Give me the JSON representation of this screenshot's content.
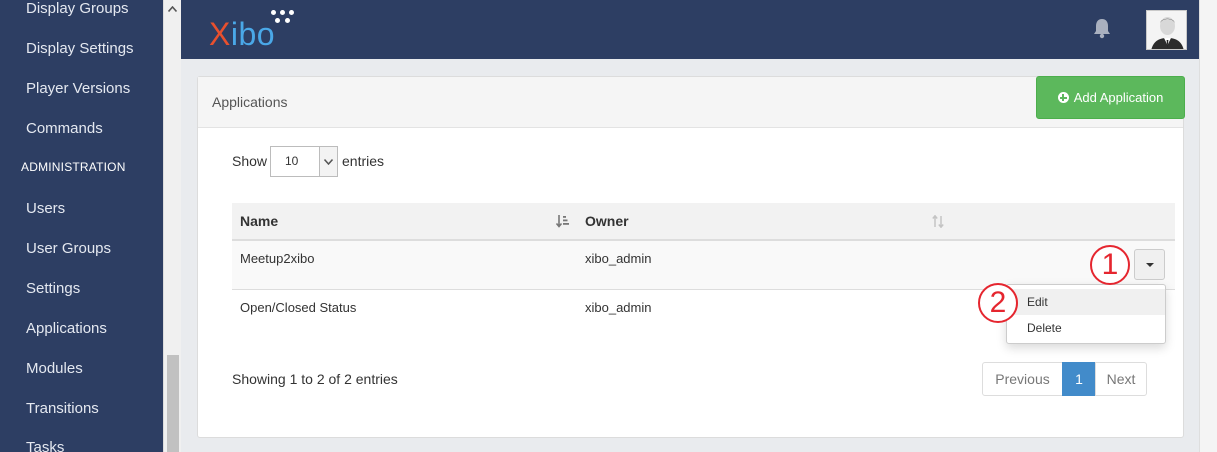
{
  "sidebar": {
    "items": [
      {
        "label": "Display Groups"
      },
      {
        "label": "Display Settings"
      },
      {
        "label": "Player Versions"
      },
      {
        "label": "Commands"
      },
      {
        "label": "Users"
      },
      {
        "label": "User Groups"
      },
      {
        "label": "Settings"
      },
      {
        "label": "Applications"
      },
      {
        "label": "Modules"
      },
      {
        "label": "Transitions"
      },
      {
        "label": "Tasks"
      }
    ],
    "section_admin": "ADMINISTRATION"
  },
  "navbar": {
    "logo_x": "X",
    "logo_rest": "ibo",
    "icons": {
      "notifications": "bell-icon",
      "user": "avatar"
    }
  },
  "panel": {
    "title": "Applications",
    "add_button": "Add Application",
    "add_button_icon": "plus-circle-icon"
  },
  "length": {
    "show_label": "Show",
    "value": "10",
    "entries_label": "entries"
  },
  "table": {
    "columns": [
      "Name",
      "Owner"
    ],
    "rows": [
      {
        "name": "Meetup2xibo",
        "owner": "xibo_admin"
      },
      {
        "name": "Open/Closed Status",
        "owner": "xibo_admin"
      }
    ]
  },
  "row_menu": {
    "items": [
      "Edit",
      "Delete"
    ]
  },
  "annotations": [
    "1",
    "2"
  ],
  "footer": {
    "info": "Showing 1 to 2 of 2 entries",
    "previous": "Previous",
    "current_page": "1",
    "next": "Next"
  },
  "colors": {
    "sidebar_bg": "#2d3e63",
    "navbar_bg": "#2d3e63",
    "logo_x": "#e8502e",
    "logo_rest": "#4aa8e8",
    "success": "#5cb85c",
    "primary": "#428bca",
    "annotation": "#e5262f"
  }
}
